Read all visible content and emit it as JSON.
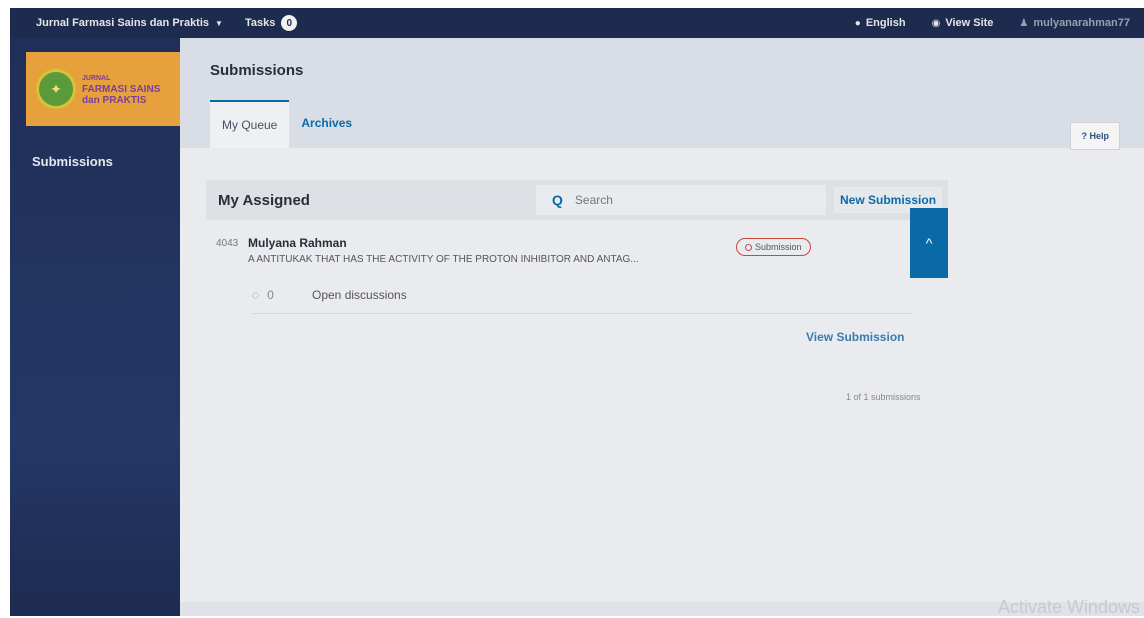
{
  "topbar": {
    "journal_name": "Jurnal Farmasi Sains dan Praktis",
    "tasks_label": "Tasks",
    "tasks_count": "0",
    "language": "English",
    "view_site": "View Site",
    "username": "mulyanarahman77"
  },
  "logo": {
    "line1": "JURNAL",
    "line2": "FARMASI SAINS",
    "line3": "dan PRAKTIS"
  },
  "sidebar": {
    "items": [
      {
        "label": "Submissions"
      }
    ]
  },
  "header": {
    "title": "Submissions",
    "tabs": [
      {
        "label": "My Queue"
      },
      {
        "label": "Archives"
      }
    ],
    "help_label": "Help"
  },
  "panel": {
    "title": "My Assigned",
    "search_placeholder": "Search",
    "new_submission_label": "New Submission",
    "submission": {
      "id": "4043",
      "author": "Mulyana Rahman",
      "title": "A ANTITUKAK THAT HAS THE ACTIVITY OF THE PROTON INHIBITOR AND ANTAG...",
      "stage": "Submission",
      "discussion_count": "0",
      "discussions_label": "Open discussions",
      "view_label": "View Submission"
    },
    "pagination": "1 of 1 submissions"
  },
  "watermark": "Activate Windows",
  "colors": {
    "accent": "#0a6aa8",
    "topbar": "#1c2b4e",
    "logo_bg": "#e7a13c",
    "stage_border": "#c9473c"
  }
}
